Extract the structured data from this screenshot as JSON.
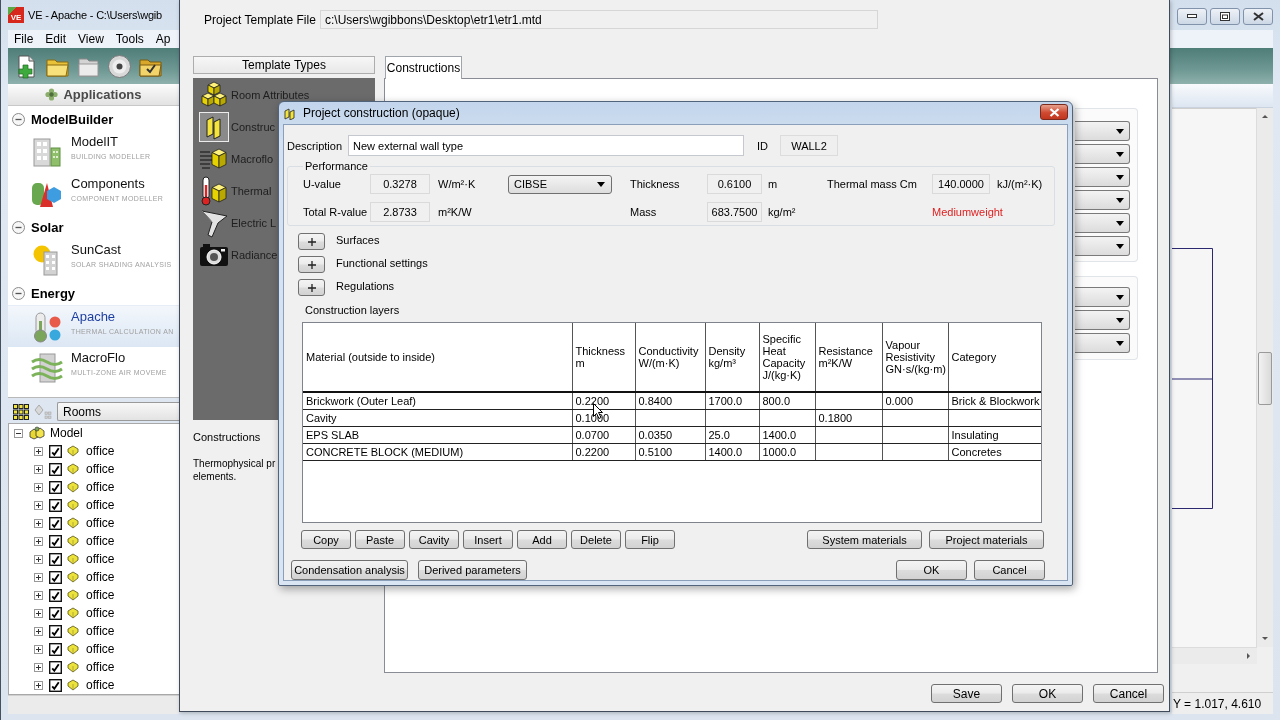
{
  "main_window": {
    "logo": "VE",
    "title": "VE - Apache - C:\\Users\\wgib",
    "menu": [
      "File",
      "Edit",
      "View",
      "Tools",
      "Ap"
    ],
    "applications": {
      "title": "Applications",
      "groups": [
        {
          "name": "ModelBuilder",
          "expanded": true,
          "items": [
            {
              "name": "ModelIT",
              "subtitle": "BUILDING MODELLER",
              "selected": false
            },
            {
              "name": "Components",
              "subtitle": "COMPONENT MODELLER",
              "selected": false
            }
          ]
        },
        {
          "name": "Solar",
          "expanded": true,
          "items": [
            {
              "name": "SunCast",
              "subtitle": "SOLAR SHADING ANALYSIS",
              "selected": false
            }
          ]
        },
        {
          "name": "Energy",
          "expanded": true,
          "items": [
            {
              "name": "Apache",
              "subtitle": "THERMAL CALCULATION AN",
              "selected": true
            },
            {
              "name": "MacroFlo",
              "subtitle": "MULTI-ZONE AIR MOVEME",
              "selected": false
            }
          ]
        }
      ]
    },
    "model_tree": {
      "view": "Rooms",
      "root": {
        "label": "Model",
        "expanded": true,
        "children": [
          {
            "label": "office",
            "checked": true,
            "expanded": false
          },
          {
            "label": "office",
            "checked": true,
            "expanded": false
          },
          {
            "label": "office",
            "checked": true,
            "expanded": false
          },
          {
            "label": "office",
            "checked": true,
            "expanded": false
          },
          {
            "label": "office",
            "checked": true,
            "expanded": false
          },
          {
            "label": "office",
            "checked": true,
            "expanded": false
          },
          {
            "label": "office",
            "checked": true,
            "expanded": false
          },
          {
            "label": "office",
            "checked": true,
            "expanded": false
          },
          {
            "label": "office",
            "checked": true,
            "expanded": false
          },
          {
            "label": "office",
            "checked": true,
            "expanded": false
          },
          {
            "label": "office",
            "checked": true,
            "expanded": false
          },
          {
            "label": "office",
            "checked": true,
            "expanded": false
          },
          {
            "label": "office",
            "checked": true,
            "expanded": false
          },
          {
            "label": "office",
            "checked": true,
            "expanded": false
          }
        ]
      }
    },
    "status_bar": {
      "coordinates": "Y = 1.017, 4.610"
    }
  },
  "template_dialog": {
    "file_label": "Project Template File",
    "file_path": "c:\\Users\\wgibbons\\Desktop\\etr1\\etr1.mtd",
    "template_types": {
      "title": "Template Types",
      "items": [
        {
          "label": "Room Attributes",
          "selected": false
        },
        {
          "label": "Construc",
          "selected": true
        },
        {
          "label": "Macroflo",
          "selected": false
        },
        {
          "label": "Thermal",
          "selected": false
        },
        {
          "label": "Electric L",
          "selected": false
        },
        {
          "label": "Radiance",
          "selected": false
        }
      ]
    },
    "selection": {
      "title": "Constructions",
      "description_lines": [
        "Thermophysical pr",
        "elements."
      ]
    },
    "tabs": [
      {
        "label": "Constructions",
        "selected": true
      }
    ],
    "buttons": [
      "Save",
      "OK",
      "Cancel"
    ]
  },
  "construction_dialog": {
    "title": "Project construction (opaque)",
    "description": {
      "label": "Description",
      "value": "New external wall type"
    },
    "id": {
      "label": "ID",
      "value": "WALL2"
    },
    "performance": {
      "title": "Performance",
      "u_value": {
        "label": "U-value",
        "value": "0.3278",
        "unit": "W/m²·K"
      },
      "standard": "CIBSE",
      "thickness": {
        "label": "Thickness",
        "value": "0.6100",
        "unit": "m"
      },
      "thermal_mass": {
        "label": "Thermal mass Cm",
        "value": "140.0000",
        "unit": "kJ/(m²·K)"
      },
      "total_r_value": {
        "label": "Total R-value",
        "value": "2.8733",
        "unit": "m²K/W"
      },
      "mass": {
        "label": "Mass",
        "value": "683.7500",
        "unit": "kg/m²"
      },
      "weight_class": "Mediumweight"
    },
    "sections": [
      {
        "label": "Surfaces",
        "expanded": false
      },
      {
        "label": "Functional settings",
        "expanded": false
      },
      {
        "label": "Regulations",
        "expanded": false
      }
    ],
    "layers": {
      "title": "Construction layers",
      "columns": [
        "Material (outside to inside)",
        "Thickness\nm",
        "Conductivity\nW/(m·K)",
        "Density\nkg/m³",
        "Specific\nHeat\nCapacity\nJ/(kg·K)",
        "Resistance\nm²K/W",
        "Vapour\nResistivity\nGN·s/(kg·m)",
        "Category"
      ],
      "rows": [
        {
          "material": "Brickwork (Outer Leaf)",
          "thickness": "0.2200",
          "conductivity": "0.8400",
          "density": "1700.0",
          "specific_heat_capacity": "800.0",
          "vapour_resistivity": "0.000",
          "category": "Brick & Blockwork"
        },
        {
          "material": "Cavity",
          "thickness": "0.1000",
          "resistance": "0.1800"
        },
        {
          "material": "EPS SLAB",
          "thickness": "0.0700",
          "conductivity": "0.0350",
          "density": "25.0",
          "specific_heat_capacity": "1400.0",
          "category": "Insulating"
        },
        {
          "material": "CONCRETE BLOCK (MEDIUM)",
          "thickness": "0.2200",
          "conductivity": "0.5100",
          "density": "1400.0",
          "specific_heat_capacity": "1000.0",
          "category": "Concretes"
        }
      ]
    },
    "layer_buttons": [
      "Copy",
      "Paste",
      "Cavity",
      "Insert",
      "Add",
      "Delete",
      "Flip"
    ],
    "material_buttons": [
      "System materials",
      "Project materials"
    ],
    "analysis_buttons": [
      "Condensation analysis",
      "Derived parameters"
    ],
    "buttons": [
      "OK",
      "Cancel"
    ]
  }
}
